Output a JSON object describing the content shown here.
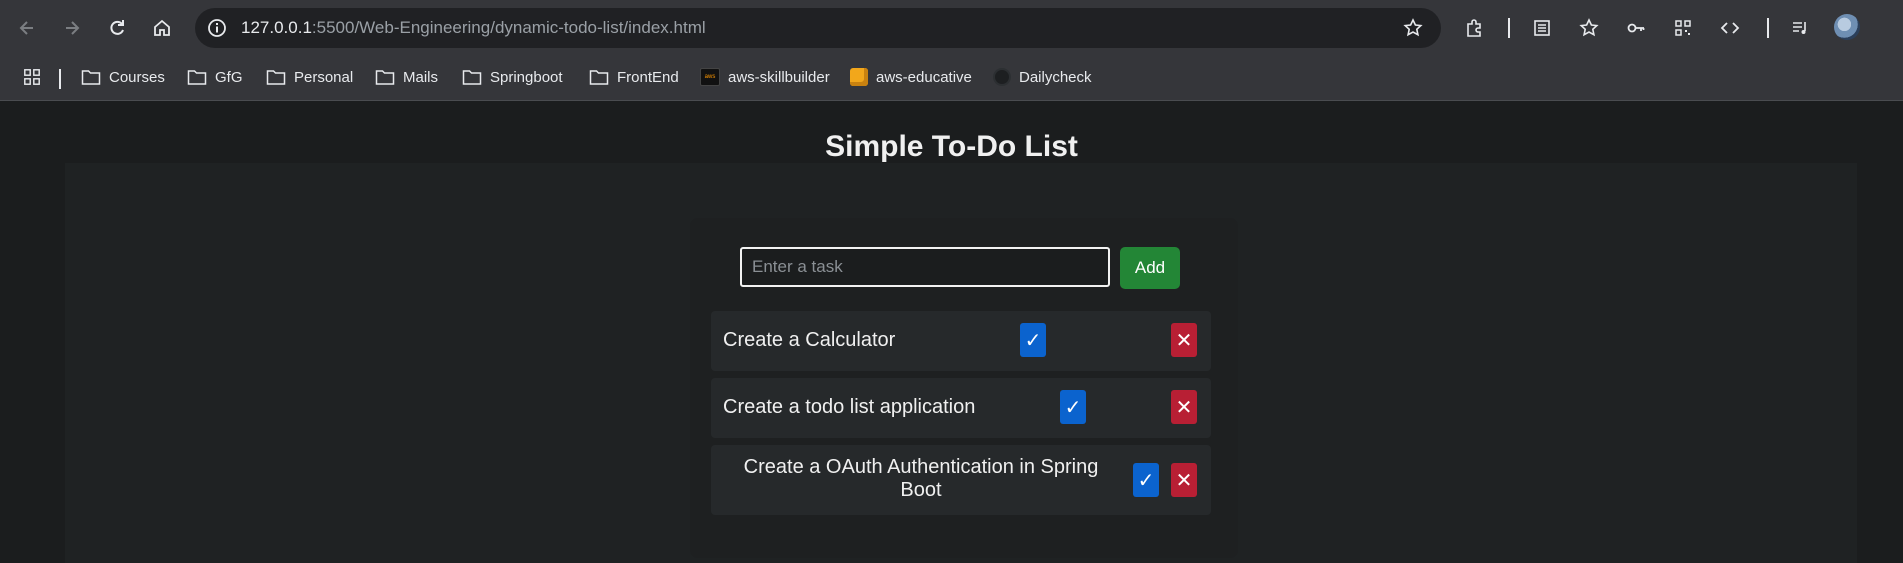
{
  "browser": {
    "url_host": "127.0.0.1",
    "url_path": ":5500/Web-Engineering/dynamic-todo-list/index.html"
  },
  "bookmarks": [
    {
      "label": "Courses"
    },
    {
      "label": "GfG"
    },
    {
      "label": "Personal"
    },
    {
      "label": "Mails"
    },
    {
      "label": "Springboot"
    },
    {
      "label": "FrontEnd"
    },
    {
      "label": "aws-skillbuilder"
    },
    {
      "label": "aws-educative"
    },
    {
      "label": "Dailycheck"
    }
  ],
  "app": {
    "title": "Simple To-Do List",
    "input_placeholder": "Enter a task",
    "add_label": "Add",
    "check_symbol": "✓",
    "delete_symbol": "✕",
    "tasks": [
      {
        "text": "Create a Calculator"
      },
      {
        "text": "Create a todo list application"
      },
      {
        "text": "Create a OAuth Authentication in Spring Boot"
      }
    ]
  },
  "colors": {
    "add_button": "#238636",
    "complete_button": "#0b63ce",
    "delete_button": "#b81f34"
  }
}
